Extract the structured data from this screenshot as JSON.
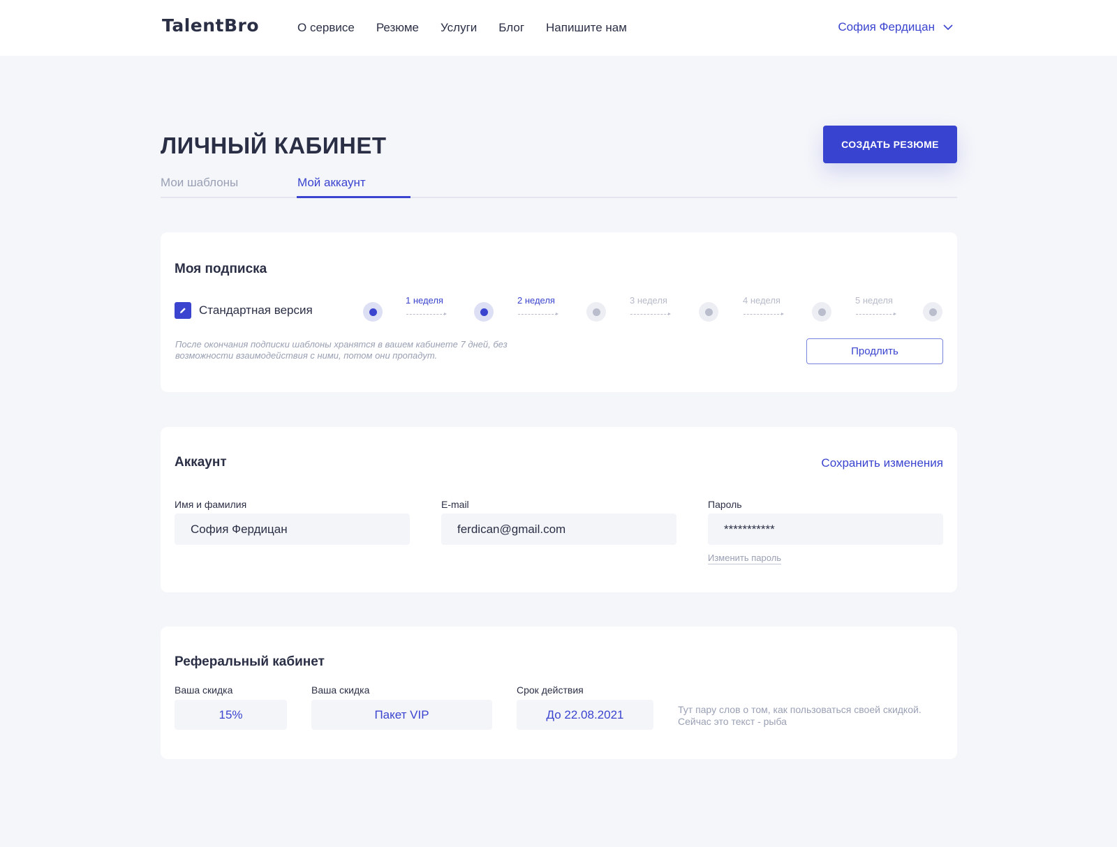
{
  "header": {
    "logo": "TalentBro",
    "nav": [
      "О сервисе",
      "Резюме",
      "Услуги",
      "Блог",
      "Напишите нам"
    ],
    "user_name": "София Фердицан"
  },
  "page": {
    "title": "ЛИЧНЫЙ КАБИНЕТ",
    "create_button": "СОЗДАТЬ РЕЗЮМЕ",
    "tabs": [
      {
        "label": "Мои шаблоны",
        "active": false
      },
      {
        "label": "Мой аккаунт",
        "active": true
      }
    ]
  },
  "subscription": {
    "title": "Моя подписка",
    "plan": "Стандартная версия",
    "weeks": [
      {
        "label": "1 неделя",
        "active": true
      },
      {
        "label": "2 неделя",
        "active": true
      },
      {
        "label": "3 неделя",
        "active": false
      },
      {
        "label": "4 неделя",
        "active": false
      },
      {
        "label": "5 неделя",
        "active": false
      }
    ],
    "note": "После окончания подписки шаблоны хранятся в вашем кабинете 7 дней, без возможности взаимодействия с ними, потом они пропадут.",
    "extend_button": "Продлить"
  },
  "account": {
    "title": "Аккаунт",
    "save_link": "Сохранить изменения",
    "name_label": "Имя и фамилия",
    "name_value": "София Фердицан",
    "email_label": "E-mail",
    "email_value": "ferdican@gmail.com",
    "password_label": "Пароль",
    "password_value": "***********",
    "change_password": "Изменить пароль"
  },
  "referral": {
    "title": "Реферальный кабинет",
    "discount_label": "Ваша скидка",
    "discount_value": "15%",
    "package_label": "Ваша скидка",
    "package_value": "Пакет VIP",
    "validity_label": "Срок действия",
    "validity_value": "До 22.08.2021",
    "hint": "Тут пару слов о том, как пользоваться своей скидкой. Сейчас это текст - рыба"
  },
  "colors": {
    "accent": "#3a44cf",
    "background": "#f5f6fa",
    "muted": "#9aa0b4"
  }
}
